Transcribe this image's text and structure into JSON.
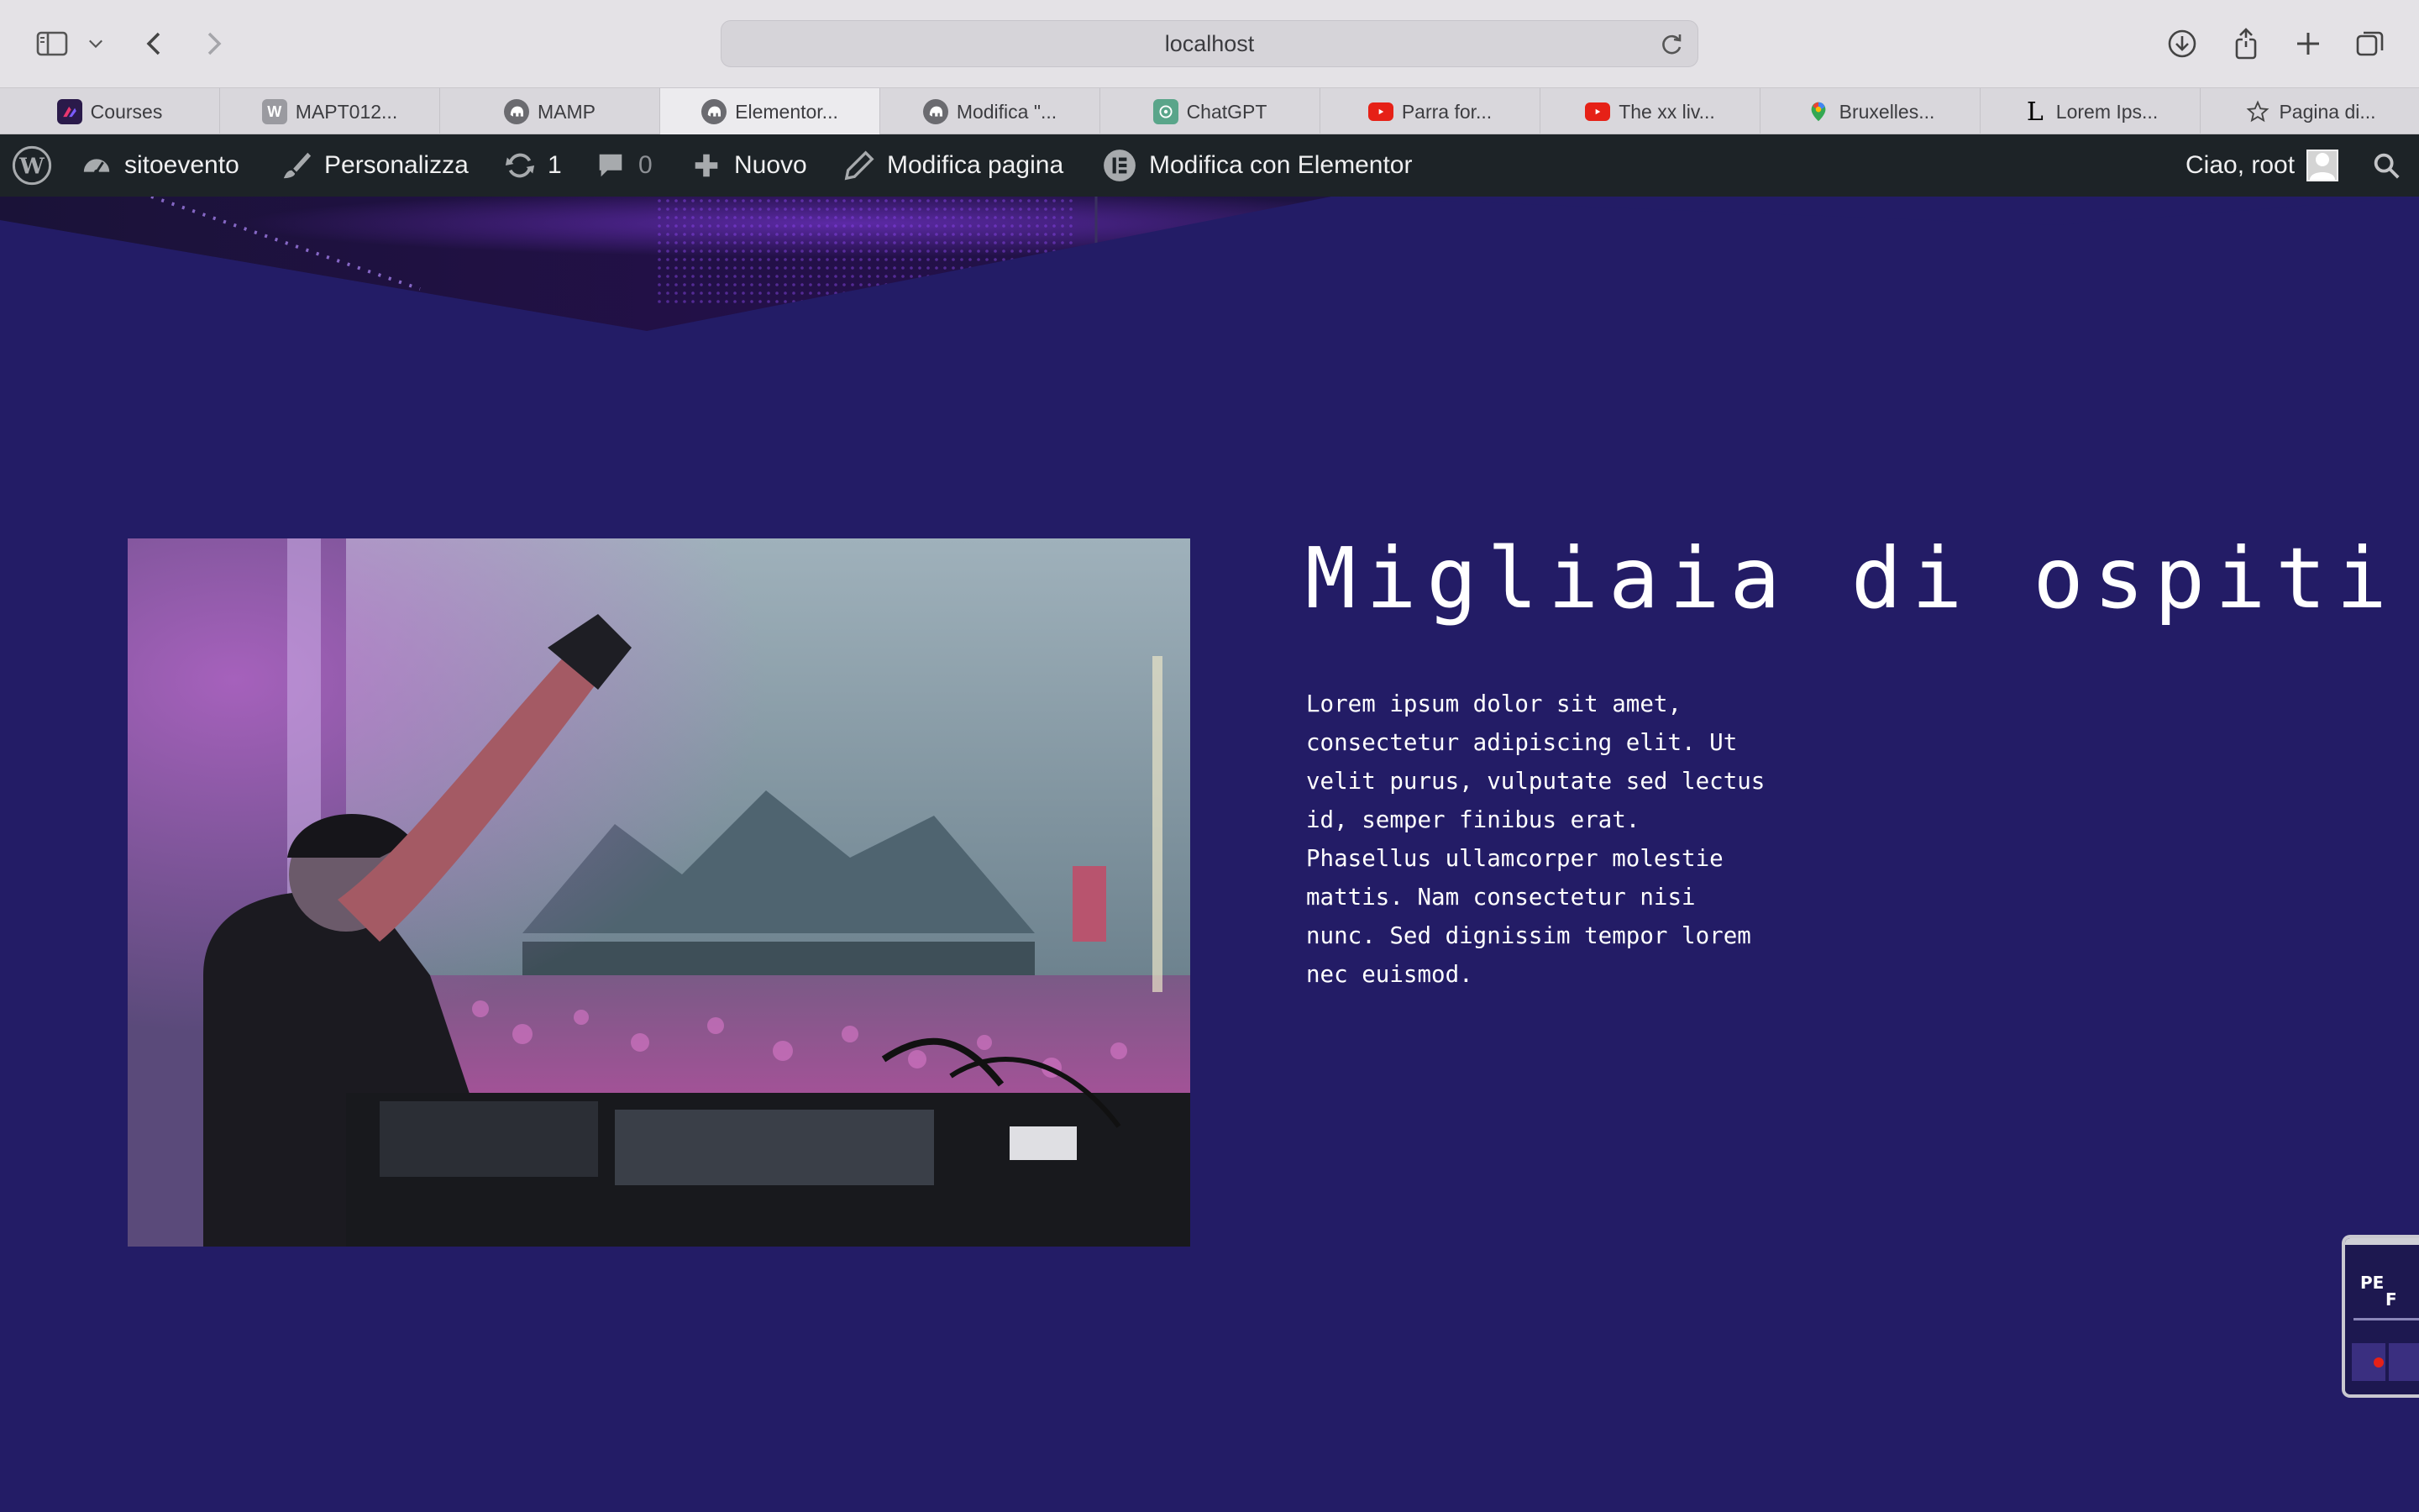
{
  "browser": {
    "url": "localhost",
    "tabs": [
      {
        "label": "Courses",
        "icon": "courses-icon",
        "color": "#2a1a4a"
      },
      {
        "label": "MAPT012...",
        "icon": "w-icon",
        "color": "#9a9aa0"
      },
      {
        "label": "MAMP",
        "icon": "elephant-icon",
        "color": "#6b6b70"
      },
      {
        "label": "Elementor...",
        "icon": "elephant-icon",
        "color": "#6b6b70",
        "active": true
      },
      {
        "label": "Modifica \"...",
        "icon": "elephant-icon",
        "color": "#6b6b70"
      },
      {
        "label": "ChatGPT",
        "icon": "chatgpt-icon",
        "color": "#5aa58a"
      },
      {
        "label": "Parra for...",
        "icon": "youtube-icon",
        "color": "#e62117"
      },
      {
        "label": "The xx liv...",
        "icon": "youtube-icon",
        "color": "#e62117"
      },
      {
        "label": "Bruxelles...",
        "icon": "maps-icon",
        "color": "#34a853"
      },
      {
        "label": "Lorem Ips...",
        "icon": "lorem-icon",
        "color": "#000000"
      },
      {
        "label": "Pagina di...",
        "icon": "star-icon",
        "color": "#555555"
      }
    ]
  },
  "adminbar": {
    "site": "sitoevento",
    "customize": "Personalizza",
    "updates": "1",
    "comments": "0",
    "new": "Nuovo",
    "edit_page": "Modifica pagina",
    "edit_elementor": "Modifica con Elementor",
    "greeting": "Ciao, root"
  },
  "content": {
    "heading": "Migliaia di ospiti",
    "body": "Lorem ipsum dolor sit amet, consectetur adipiscing elit. Ut velit purus, vulputate sed lectus id, semper finibus erat. Phasellus ullamcorper molestie mattis. Nam consectetur nisi nunc. Sed dignissim tempor lorem nec euismod."
  },
  "colors": {
    "page_bg": "#231c66",
    "adminbar_bg": "#1d2327"
  }
}
